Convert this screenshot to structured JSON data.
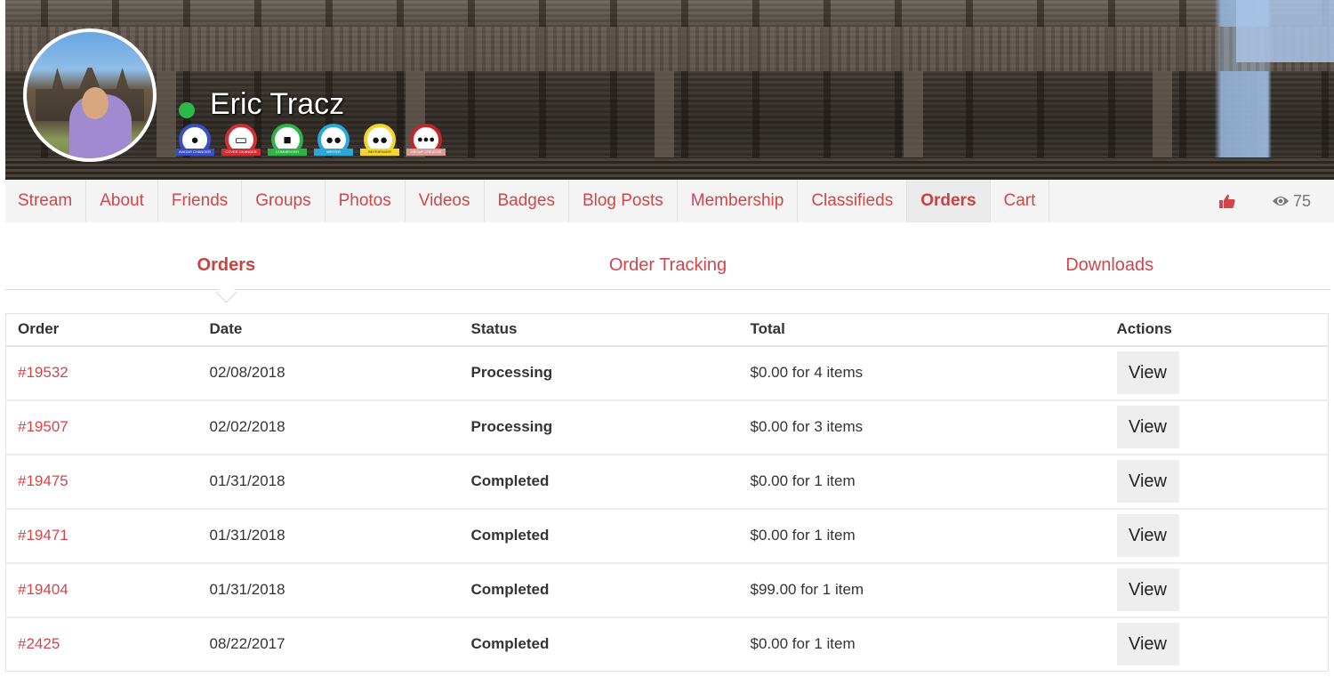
{
  "profile": {
    "name": "Eric Tracz",
    "online": true,
    "online_color": "#2db84c",
    "badges": [
      {
        "label": "AVATAR CHANGER",
        "icon": "user-icon",
        "glyph": "👤",
        "color": "#3a4fc4"
      },
      {
        "label": "COVER CHANGER",
        "icon": "laptop-icon",
        "glyph": "💻",
        "color": "#cf2f35"
      },
      {
        "label": "COMMENTER",
        "icon": "comment-icon",
        "glyph": "💬",
        "color": "#2fb24a"
      },
      {
        "label": "WRITER",
        "icon": "users-icon",
        "glyph": "👥",
        "color": "#2aa8d8"
      },
      {
        "label": "BEFRIENDER",
        "icon": "users-icon",
        "glyph": "👥",
        "color": "#f3d52b"
      },
      {
        "label": "GROUP CREATOR",
        "icon": "group-icon",
        "glyph": "👪",
        "color": "#c2262c"
      }
    ]
  },
  "nav": {
    "items": [
      {
        "label": "Stream",
        "active": false
      },
      {
        "label": "About",
        "active": false
      },
      {
        "label": "Friends",
        "active": false
      },
      {
        "label": "Groups",
        "active": false
      },
      {
        "label": "Photos",
        "active": false
      },
      {
        "label": "Videos",
        "active": false
      },
      {
        "label": "Badges",
        "active": false
      },
      {
        "label": "Blog Posts",
        "active": false
      },
      {
        "label": "Membership",
        "active": false
      },
      {
        "label": "Classifieds",
        "active": false
      },
      {
        "label": "Orders",
        "active": true
      },
      {
        "label": "Cart",
        "active": false
      }
    ],
    "like_icon": "thumbs-up-icon",
    "views_icon": "eye-icon",
    "views_count": "75",
    "accent_color": "#d0464a"
  },
  "subtabs": [
    {
      "label": "Orders",
      "active": true
    },
    {
      "label": "Order Tracking",
      "active": false
    },
    {
      "label": "Downloads",
      "active": false
    }
  ],
  "orders_table": {
    "columns": [
      "Order",
      "Date",
      "Status",
      "Total",
      "Actions"
    ],
    "rows": [
      {
        "order": "#19532",
        "date": "02/08/2018",
        "status": "Processing",
        "total": "$0.00 for 4 items",
        "action": "View"
      },
      {
        "order": "#19507",
        "date": "02/02/2018",
        "status": "Processing",
        "total": "$0.00 for 3 items",
        "action": "View"
      },
      {
        "order": "#19475",
        "date": "01/31/2018",
        "status": "Completed",
        "total": "$0.00 for 1 item",
        "action": "View"
      },
      {
        "order": "#19471",
        "date": "01/31/2018",
        "status": "Completed",
        "total": "$0.00 for 1 item",
        "action": "View"
      },
      {
        "order": "#19404",
        "date": "01/31/2018",
        "status": "Completed",
        "total": "$99.00 for 1 item",
        "action": "View"
      },
      {
        "order": "#2425",
        "date": "08/22/2017",
        "status": "Completed",
        "total": "$0.00 for 1 item",
        "action": "View"
      }
    ]
  }
}
